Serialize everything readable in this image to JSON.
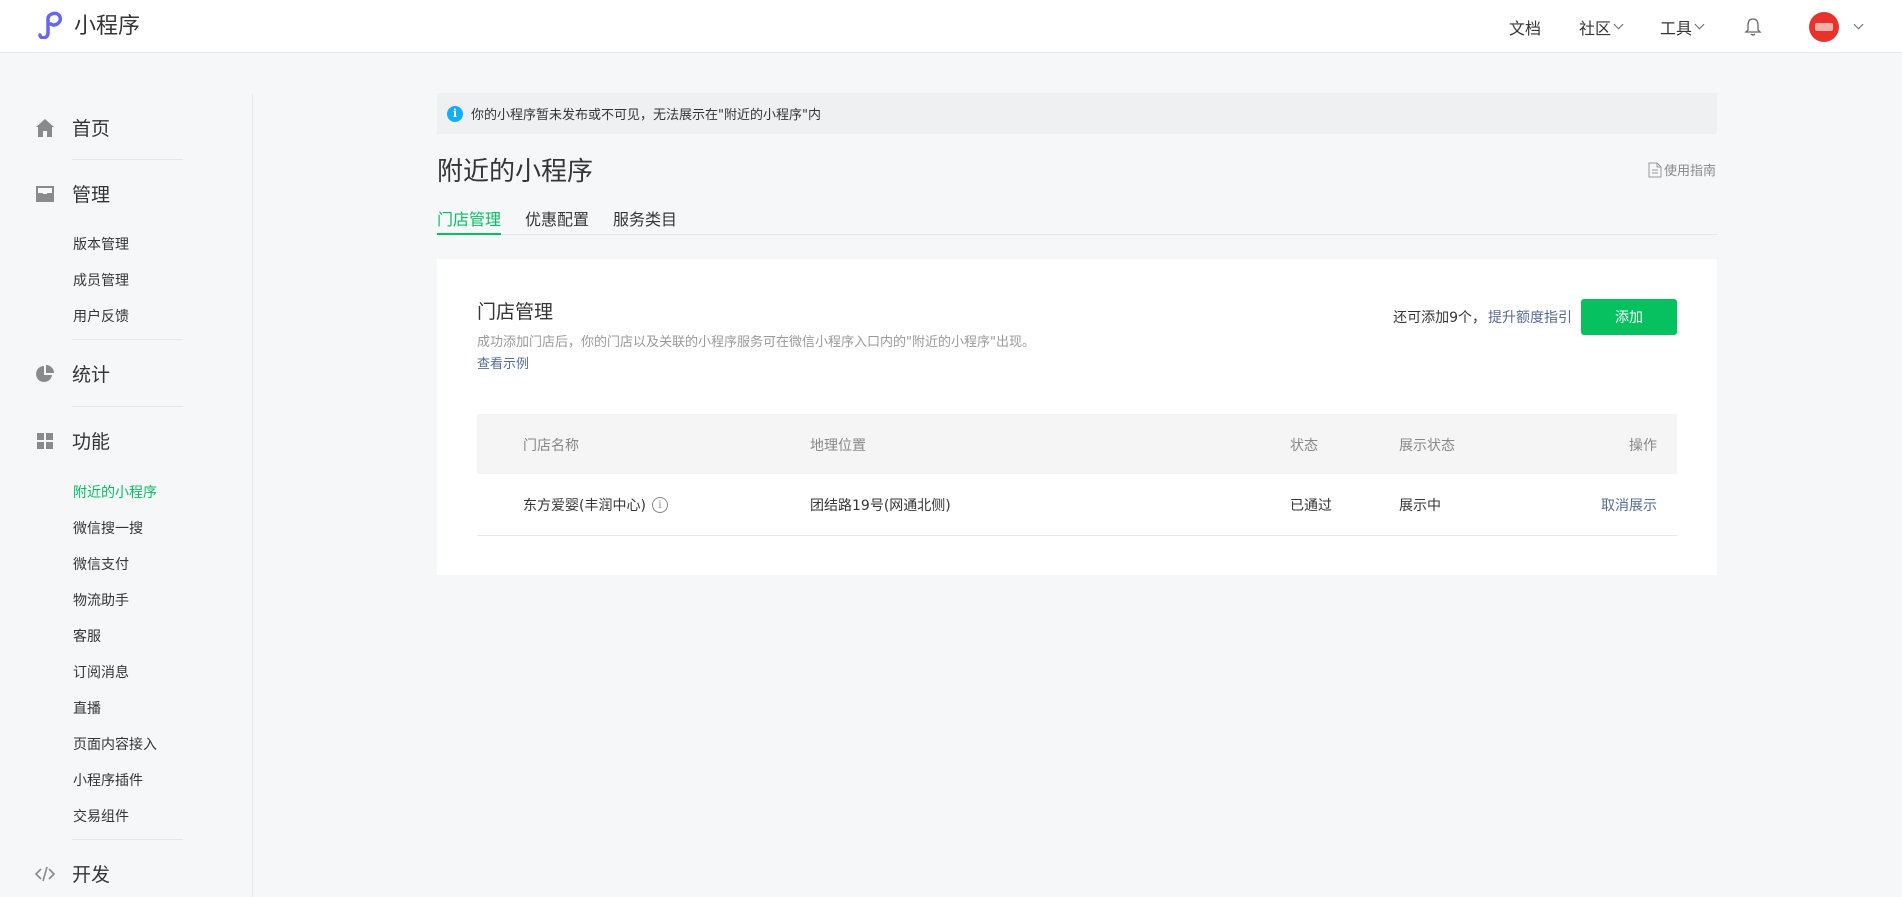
{
  "header": {
    "app_title": "小程序",
    "nav": [
      {
        "label": "文档"
      },
      {
        "label": "社区"
      },
      {
        "label": "工具"
      }
    ],
    "icons": {
      "logo": "miniprogram-logo-icon",
      "bell": "bell-icon",
      "avatar": "user-avatar"
    }
  },
  "sidebar": {
    "home": "首页",
    "manage": "管理",
    "manage_items": [
      "版本管理",
      "成员管理",
      "用户反馈"
    ],
    "stats": "统计",
    "features": "功能",
    "feature_items": [
      "附近的小程序",
      "微信搜一搜",
      "微信支付",
      "物流助手",
      "客服",
      "订阅消息",
      "直播",
      "页面内容接入",
      "小程序插件",
      "交易组件"
    ],
    "active_item": "附近的小程序",
    "develop": "开发"
  },
  "notice": {
    "text": "你的小程序暂未发布或不可见，无法展示在\"附近的小程序\"内"
  },
  "page": {
    "title": "附近的小程序",
    "guide": "使用指南",
    "tabs": [
      "门店管理",
      "优惠配置",
      "服务类目"
    ],
    "active_tab": "门店管理"
  },
  "card": {
    "title": "门店管理",
    "desc": "成功添加门店后，你的门店以及关联的小程序服务可在微信小程序入口内的\"附近的小程序\"出现。",
    "example_link": "查看示例",
    "quota_text": "还可添加9个，",
    "quota_link": "提升额度指引",
    "add_button": "添加"
  },
  "table": {
    "headers": [
      "门店名称",
      "地理位置",
      "状态",
      "展示状态",
      "操作"
    ],
    "rows": [
      {
        "name": "东方爱婴(丰润中心)",
        "location": "团结路19号(网通北侧)",
        "status": "已通过",
        "display": "展示中",
        "action": "取消展示"
      }
    ]
  },
  "colors": {
    "accent": "#07c160",
    "link": "#576b95",
    "info": "#10aeff",
    "avatar": "#e8332c",
    "background": "#f6f7f9"
  }
}
